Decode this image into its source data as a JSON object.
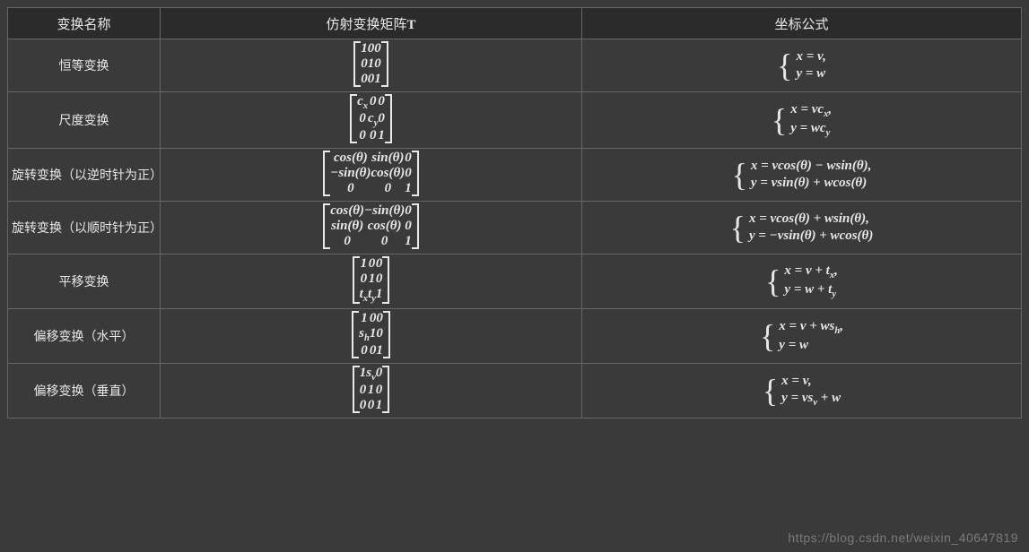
{
  "headers": {
    "name": "变换名称",
    "matrix_prefix": "仿射变换矩阵",
    "matrix_T": "T",
    "formula": "坐标公式"
  },
  "rows": [
    {
      "name": "恒等变换",
      "matrix": [
        [
          "1",
          "0",
          "0"
        ],
        [
          "0",
          "1",
          "0"
        ],
        [
          "0",
          "0",
          "1"
        ]
      ],
      "formula": [
        "x = v,",
        "y = w"
      ]
    },
    {
      "name": "尺度变换",
      "matrix": [
        [
          "c<sub class='sub'>x</sub>",
          "0",
          "0"
        ],
        [
          "0",
          "c<sub class='sub'>y</sub>",
          "0"
        ],
        [
          "0",
          "0",
          "1"
        ]
      ],
      "formula": [
        "x = vc<sub class='sub'>x</sub>,",
        "y = wc<sub class='sub'>y</sub>"
      ]
    },
    {
      "name": "旋转变换（以逆时针为正）",
      "matrix": [
        [
          "cos(θ)",
          "sin(θ)",
          "0"
        ],
        [
          "−sin(θ)",
          "cos(θ)",
          "0"
        ],
        [
          "0",
          "0",
          "1"
        ]
      ],
      "formula": [
        "x = vcos(θ) − wsin(θ),",
        "y = vsin(θ) + wcos(θ)"
      ]
    },
    {
      "name": "旋转变换（以顺时针为正）",
      "matrix": [
        [
          "cos(θ)",
          "−sin(θ)",
          "0"
        ],
        [
          "sin(θ)",
          "cos(θ)",
          "0"
        ],
        [
          "0",
          "0",
          "1"
        ]
      ],
      "formula": [
        "x = vcos(θ) + wsin(θ),",
        "y = −vsin(θ) + wcos(θ)"
      ]
    },
    {
      "name": "平移变换",
      "matrix": [
        [
          "1",
          "0",
          "0"
        ],
        [
          "0",
          "1",
          "0"
        ],
        [
          "t<sub class='sub'>x</sub>",
          "t<sub class='sub'>y</sub>",
          "1"
        ]
      ],
      "formula": [
        "x = v + t<sub class='sub'>x</sub>,",
        "y = w + t<sub class='sub'>y</sub>"
      ]
    },
    {
      "name": "偏移变换（水平）",
      "matrix": [
        [
          "1",
          "0",
          "0"
        ],
        [
          "s<sub class='sub'>h</sub>",
          "1",
          "0"
        ],
        [
          "0",
          "0",
          "1"
        ]
      ],
      "formula": [
        "x = v + ws<sub class='sub'>h</sub>,",
        "y = w"
      ]
    },
    {
      "name": "偏移变换（垂直）",
      "matrix": [
        [
          "1",
          "s<sub class='sub'>v</sub>",
          "0"
        ],
        [
          "0",
          "1",
          "0"
        ],
        [
          "0",
          "0",
          "1"
        ]
      ],
      "formula": [
        "x = v,",
        "y = vs<sub class='sub'>v</sub> + w"
      ]
    }
  ],
  "watermark": "https://blog.csdn.net/weixin_40647819"
}
